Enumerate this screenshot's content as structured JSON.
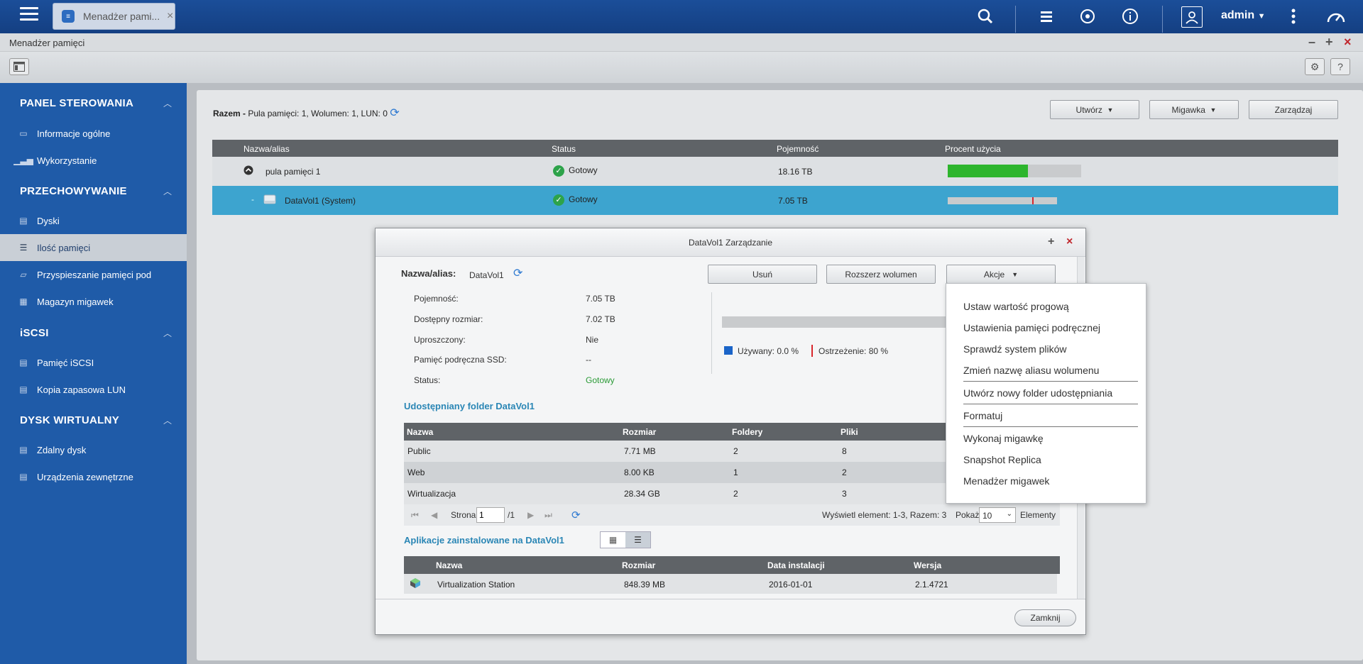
{
  "topbar": {
    "app_tab_label": "Menadżer pami...",
    "user": "admin"
  },
  "window": {
    "title": "Menadżer pamięci"
  },
  "sidebar": {
    "sections": [
      {
        "title": "PANEL STEROWANIA"
      },
      {
        "title": "PRZECHOWYWANIE"
      },
      {
        "title": "iSCSI"
      },
      {
        "title": "DYSK WIRTUALNY"
      }
    ],
    "items": [
      {
        "label": "Informacje ogólne"
      },
      {
        "label": "Wykorzystanie"
      },
      {
        "label": "Dyski"
      },
      {
        "label": "Ilość pamięci"
      },
      {
        "label": "Przyspieszanie pamięci pod"
      },
      {
        "label": "Magazyn migawek"
      },
      {
        "label": "Pamięć iSCSI"
      },
      {
        "label": "Kopia zapasowa LUN"
      },
      {
        "label": "Zdalny dysk"
      },
      {
        "label": "Urządzenia zewnętrzne"
      }
    ]
  },
  "main": {
    "summary_prefix": "Razem -",
    "summary_text": "Pula pamięci: 1, Wolumen: 1, LUN: 0",
    "buttons": {
      "create": "Utwórz",
      "snapshot": "Migawka",
      "manage": "Zarządzaj"
    },
    "columns": [
      "Nazwa/alias",
      "Status",
      "Pojemność",
      "Procent użycia"
    ],
    "pool": {
      "name": "pula pamięci 1",
      "status": "Gotowy",
      "capacity": "18.16 TB",
      "usage_fraction": 0.6
    },
    "volume": {
      "name": "DataVol1 (System)",
      "status": "Gotowy",
      "capacity": "7.05 TB"
    }
  },
  "dialog": {
    "title": "DataVol1 Zarządzanie",
    "alias_label": "Nazwa/alias:",
    "alias_value": "DataVol1",
    "buttons": {
      "remove": "Usuń",
      "extend": "Rozszerz wolumen",
      "actions": "Akcje",
      "close": "Zamknij"
    },
    "props": [
      {
        "label": "Pojemność:",
        "value": "7.05 TB"
      },
      {
        "label": "Dostępny rozmiar:",
        "value": "7.02 TB"
      },
      {
        "label": "Uproszczony:",
        "value": "Nie"
      },
      {
        "label": "Pamięć podręczna SSD:",
        "value": "--"
      },
      {
        "label": "Status:",
        "value": "Gotowy"
      }
    ],
    "legend": {
      "used": "Używany: 0.0 %",
      "warning": "Ostrzeżenie: 80 %"
    },
    "shared_title": "Udostępniany folder DataVol1",
    "shared_columns": [
      "Nazwa",
      "Rozmiar",
      "Foldery",
      "Pliki"
    ],
    "shared_rows": [
      [
        "Public",
        "7.71 MB",
        "2",
        "8"
      ],
      [
        "Web",
        "8.00 KB",
        "1",
        "2"
      ],
      [
        "Wirtualizacja",
        "28.34 GB",
        "2",
        "3"
      ]
    ],
    "pager": {
      "page_label": "Strona",
      "page_value": "1",
      "page_total": "/1",
      "display": "Wyświetl element: 1-3, Razem: 3",
      "show_label": "Pokaż",
      "show_value": "10",
      "elements": "Elementy"
    },
    "apps_title": "Aplikacje zainstalowane na DataVol1",
    "apps_columns": [
      "Nazwa",
      "Rozmiar",
      "Data instalacji",
      "Wersja"
    ],
    "apps_rows": [
      [
        "Virtualization Station",
        "848.39 MB",
        "2016-01-01",
        "2.1.4721"
      ]
    ]
  },
  "menu": {
    "items": [
      "Ustaw wartość progową",
      "Ustawienia pamięci podręcznej",
      "Sprawdź system plików",
      "Zmień nazwę aliasu wolumenu",
      "Utwórz nowy folder udostępniania",
      "Formatuj",
      "Wykonaj migawkę",
      "Snapshot Replica",
      "Menadżer migawek"
    ]
  },
  "colors": {
    "accent": "#1f5ba8",
    "selected_row": "#3da4cf",
    "ok": "#2da34a",
    "usage_bar": "#2db52d",
    "warning": "#d9262c"
  }
}
